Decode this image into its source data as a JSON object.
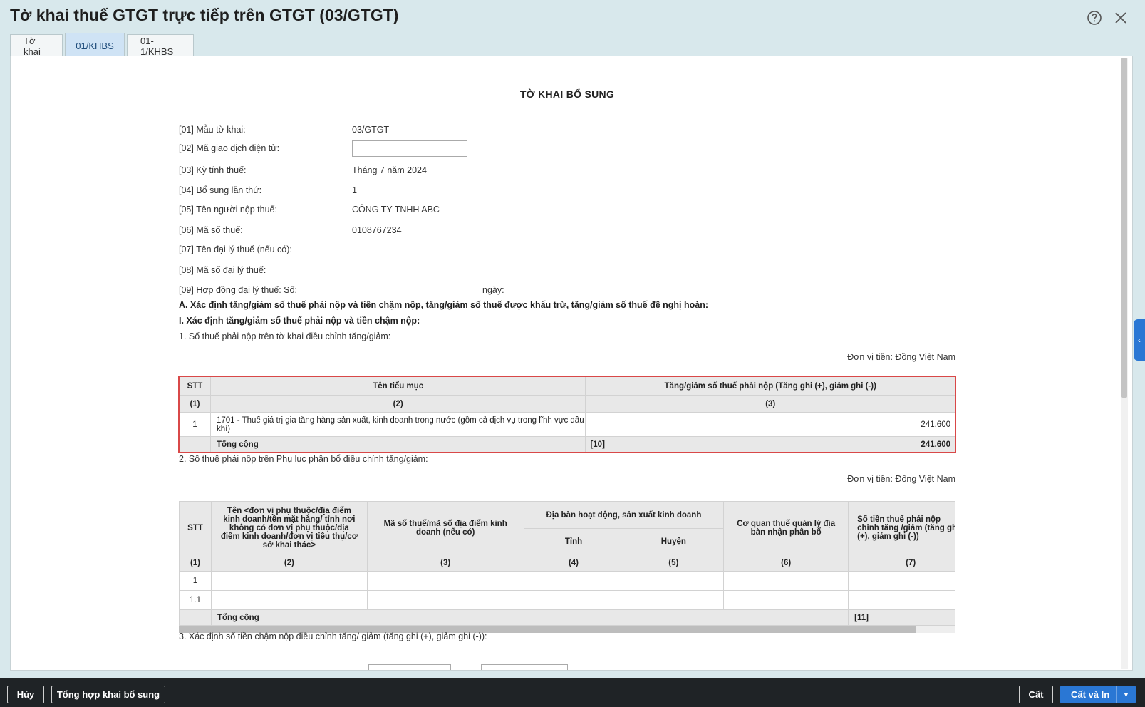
{
  "window": {
    "title": "Tờ khai thuế GTGT trực tiếp trên GTGT (03/GTGT)",
    "icons": {
      "help": "question-circle-icon",
      "close": "close-icon"
    }
  },
  "tabs": [
    {
      "label": "Tờ khai",
      "active": false
    },
    {
      "label": "01/KHBS",
      "active": true
    },
    {
      "label": "01-1/KHBS",
      "active": false
    }
  ],
  "doc": {
    "title": "TỜ KHAI BỔ SUNG",
    "fields": [
      {
        "label": "[01] Mẫu tờ khai:",
        "value": "03/GTGT"
      },
      {
        "label": "[02] Mã giao dịch điện tử:",
        "value": ""
      },
      {
        "label": "[03] Kỳ tính thuế:",
        "value": "Tháng 7 năm 2024"
      },
      {
        "label": "[04] Bổ sung lần thứ:",
        "value": "1"
      },
      {
        "label": "[05] Tên người nộp thuế:",
        "value": "CÔNG TY TNHH ABC"
      },
      {
        "label": "[06] Mã số thuế:",
        "value": "0108767234"
      },
      {
        "label": "[07] Tên đại lý thuế (nếu có):",
        "value": ""
      },
      {
        "label": "[08] Mã số đại lý thuế:",
        "value": ""
      },
      {
        "label": "[09] Hợp đồng đại lý thuế: Số:",
        "value": ""
      }
    ],
    "contract_date_label": "ngày:",
    "section_a": "A. Xác định tăng/giảm số thuế phải nộp và tiền chậm nộp, tăng/giảm số thuế được khấu trừ, tăng/giảm số thuế đề nghị hoàn:",
    "section_i": "I. Xác định tăng/giảm số thuế phải nộp và tiền chậm nộp:",
    "sub1": "1. Số thuế phải nộp trên tờ khai điều chỉnh tăng/giảm:",
    "unit": "Đơn vị tiền: Đồng Việt Nam",
    "sub2": "2. Số thuế phải nộp trên Phụ lục phân bổ điều chỉnh tăng/giảm:",
    "sub3": "3. Xác định số tiền chậm nộp điều chỉnh tăng/ giảm (tăng ghi (+), giảm ghi (-)):"
  },
  "table1": {
    "headers": [
      "STT",
      "Tên tiểu mục",
      "Tăng/giảm số thuế phải nộp (Tăng ghi (+), giảm ghi (-))"
    ],
    "col_nums": [
      "(1)",
      "(2)",
      "(3)"
    ],
    "rows": [
      {
        "stt": "1",
        "name": "1701 - Thuế giá trị gia tăng hàng sản xuất, kinh doanh trong nước (gồm cả dịch vụ trong lĩnh vực dầu khí)",
        "value": "241.600"
      }
    ],
    "total": {
      "label": "Tổng cộng",
      "code": "[10]",
      "value": "241.600"
    }
  },
  "table2": {
    "headers": {
      "stt": "STT",
      "name": "Tên <đơn vị phụ thuộc/địa điểm kinh doanh/tên mặt hàng/ tỉnh nơi không có đơn vị phụ thuộc/địa điểm kinh doanh/đơn vị tiêu thụ/cơ sở khai thác>",
      "mst": "Mã số thuế/mã số địa điểm kinh doanh (nếu có)",
      "area": "Địa bàn hoạt động, sản xuất kinh doanh",
      "province": "Tỉnh",
      "district": "Huyện",
      "agency": "Cơ quan thuế quản lý địa bàn nhận phân bổ",
      "amount": "Số tiền thuế phải nộp chỉnh tăng /giảm (tăng ghi (+), giảm ghi (-))"
    },
    "col_nums": [
      "(1)",
      "(2)",
      "(3)",
      "(4)",
      "(5)",
      "(6)",
      "(7)"
    ],
    "rows": [
      {
        "stt": "1"
      },
      {
        "stt": "1.1"
      }
    ],
    "total": {
      "label": "Tổng cộng",
      "code": "[11]"
    }
  },
  "footer": {
    "cancel": "Hủy",
    "summary": "Tổng hợp khai bổ sung",
    "save": "Cất",
    "save_print": "Cất và In"
  }
}
